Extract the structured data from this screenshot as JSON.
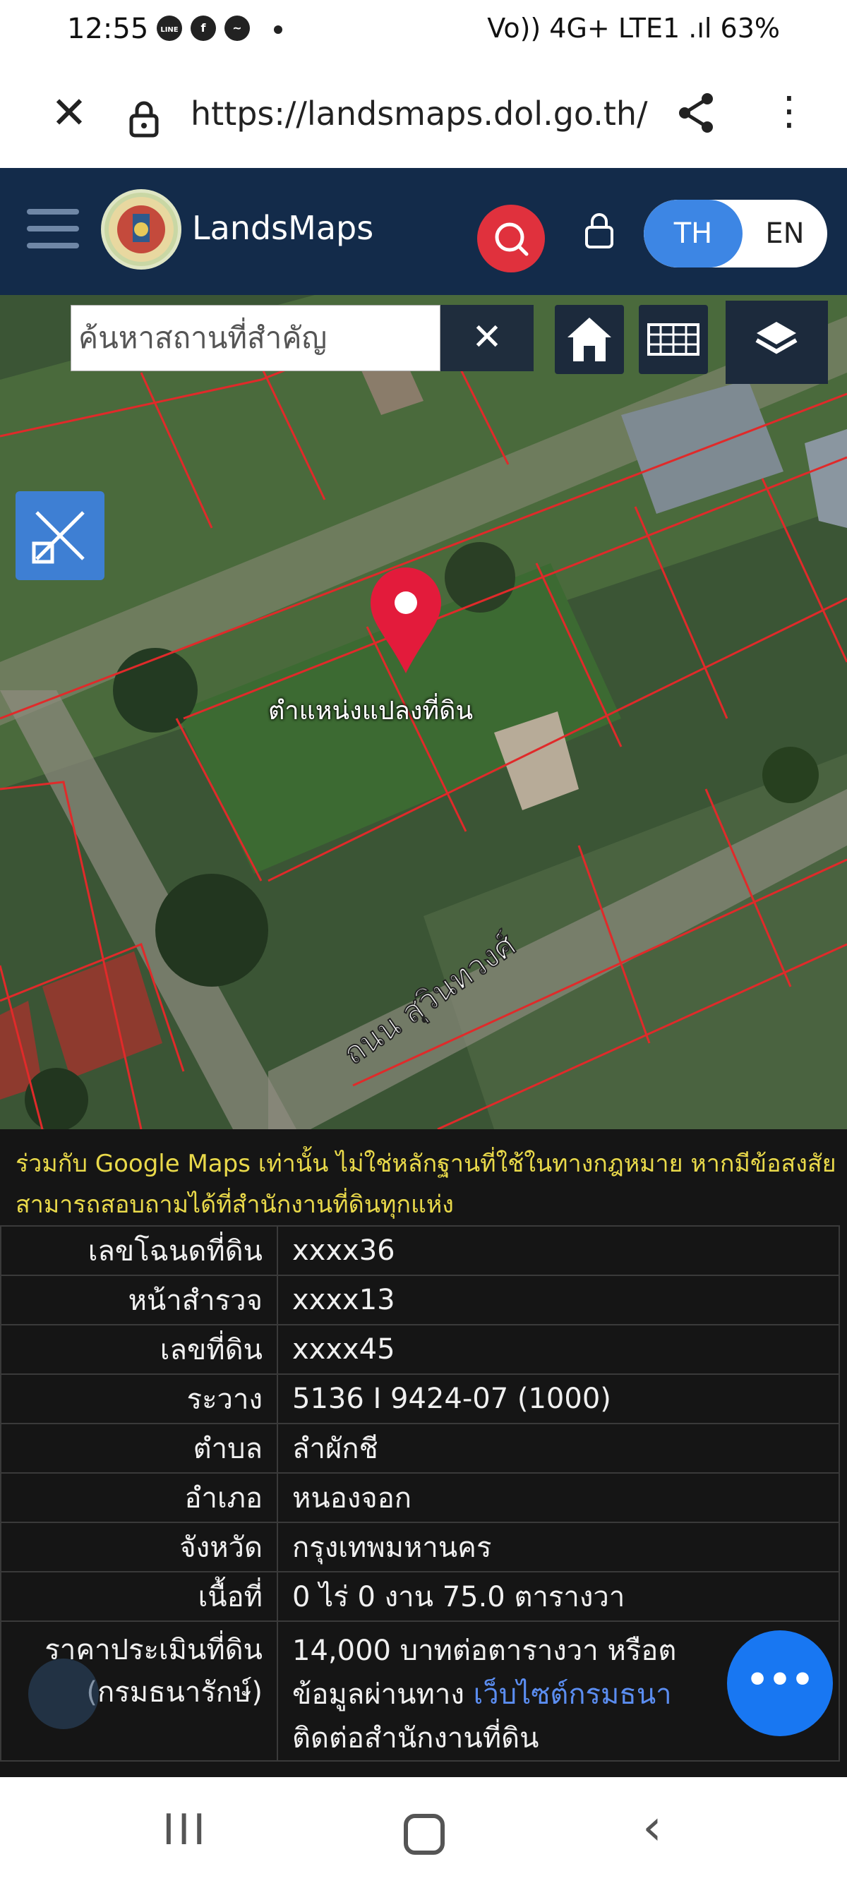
{
  "status_bar": {
    "time": "12:55",
    "left_icons": [
      "line-icon",
      "facebook-icon",
      "messenger-icon",
      "dot-icon"
    ],
    "line_label": "LINE",
    "right_text": "Vo)) 4G+ LTE1 .ıl 63%"
  },
  "browser": {
    "url": "https://landsmaps.dol.go.th/"
  },
  "app_header": {
    "brand": "LandsMaps",
    "lang_th": "TH",
    "lang_en": "EN"
  },
  "map": {
    "search_placeholder": "ค้นหาสถานที่สำคัญ",
    "clear_label": "✕",
    "pin_label": "ตำแหน่งแปลงที่ดิน",
    "road_label": "ถนน สุวินทวงศ์"
  },
  "info": {
    "disclaimer": "ร่วมกับ Google Maps เท่านั้น ไม่ใช่หลักฐานที่ใช้ในทางกฎหมาย หากมีข้อสงสัยสามารถสอบถามได้ที่สำนักงานที่ดินทุกแห่ง",
    "rows": [
      {
        "label": "เลขโฉนดที่ดิน",
        "value": "xxxx36"
      },
      {
        "label": "หน้าสำรวจ",
        "value": "xxxx13"
      },
      {
        "label": "เลขที่ดิน",
        "value": "xxxx45"
      },
      {
        "label": "ระวาง",
        "value": "5136 I 9424-07 (1000)"
      },
      {
        "label": "ตำบล",
        "value": "ลำผักชี"
      },
      {
        "label": "อำเภอ",
        "value": "หนองจอก"
      },
      {
        "label": "จังหวัด",
        "value": "กรุงเทพมหานคร"
      },
      {
        "label": "เนื้อที่",
        "value": "0 ไร่ 0 งาน 75.0 ตารางวา"
      }
    ],
    "price": {
      "label_line1": "ราคาประเมินที่ดิน",
      "label_line2": "(กรมธนารักษ์)",
      "line1": "14,000 บาทต่อตารางวา หรือต",
      "line2_prefix": "ข้อมูลผ่านทาง ",
      "line2_link": "เว็บไซต์กรมธนา",
      "line3": "ติดต่อสำนักงานที่ดิน"
    },
    "fab_label": "•••"
  },
  "nav_bar": {
    "recents": "III",
    "back": "‹"
  }
}
